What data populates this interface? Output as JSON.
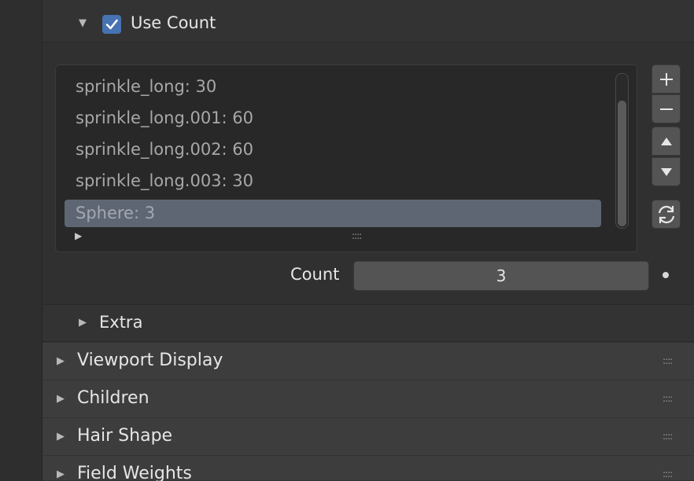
{
  "use_count": {
    "label": "Use Count",
    "checked": true,
    "disclosure": "▼"
  },
  "collection_list": {
    "items": [
      {
        "label": "sprinkle_long: 30"
      },
      {
        "label": "sprinkle_long.001: 60"
      },
      {
        "label": "sprinkle_long.002: 60"
      },
      {
        "label": "sprinkle_long.003: 30"
      },
      {
        "label": "Sphere: 3",
        "selected": true
      }
    ],
    "filter_toggle": "▶",
    "grip": "::::"
  },
  "side_buttons": {
    "add": "add-icon",
    "remove": "remove-icon",
    "move_up": "move-up-icon",
    "move_down": "move-down-icon",
    "refresh": "refresh-icon"
  },
  "count": {
    "label": "Count",
    "value": "3"
  },
  "extra": {
    "label": "Extra",
    "disclosure": "▶"
  },
  "sections": [
    {
      "label": "Viewport Display",
      "disclosure": "▶",
      "grip": "::::"
    },
    {
      "label": "Children",
      "disclosure": "▶",
      "grip": "::::"
    },
    {
      "label": "Hair Shape",
      "disclosure": "▶",
      "grip": "::::"
    },
    {
      "label": "Field Weights",
      "disclosure": "▶",
      "grip": "::::"
    }
  ],
  "colors": {
    "accent": "#4772b3",
    "selection": "#5f6673"
  }
}
